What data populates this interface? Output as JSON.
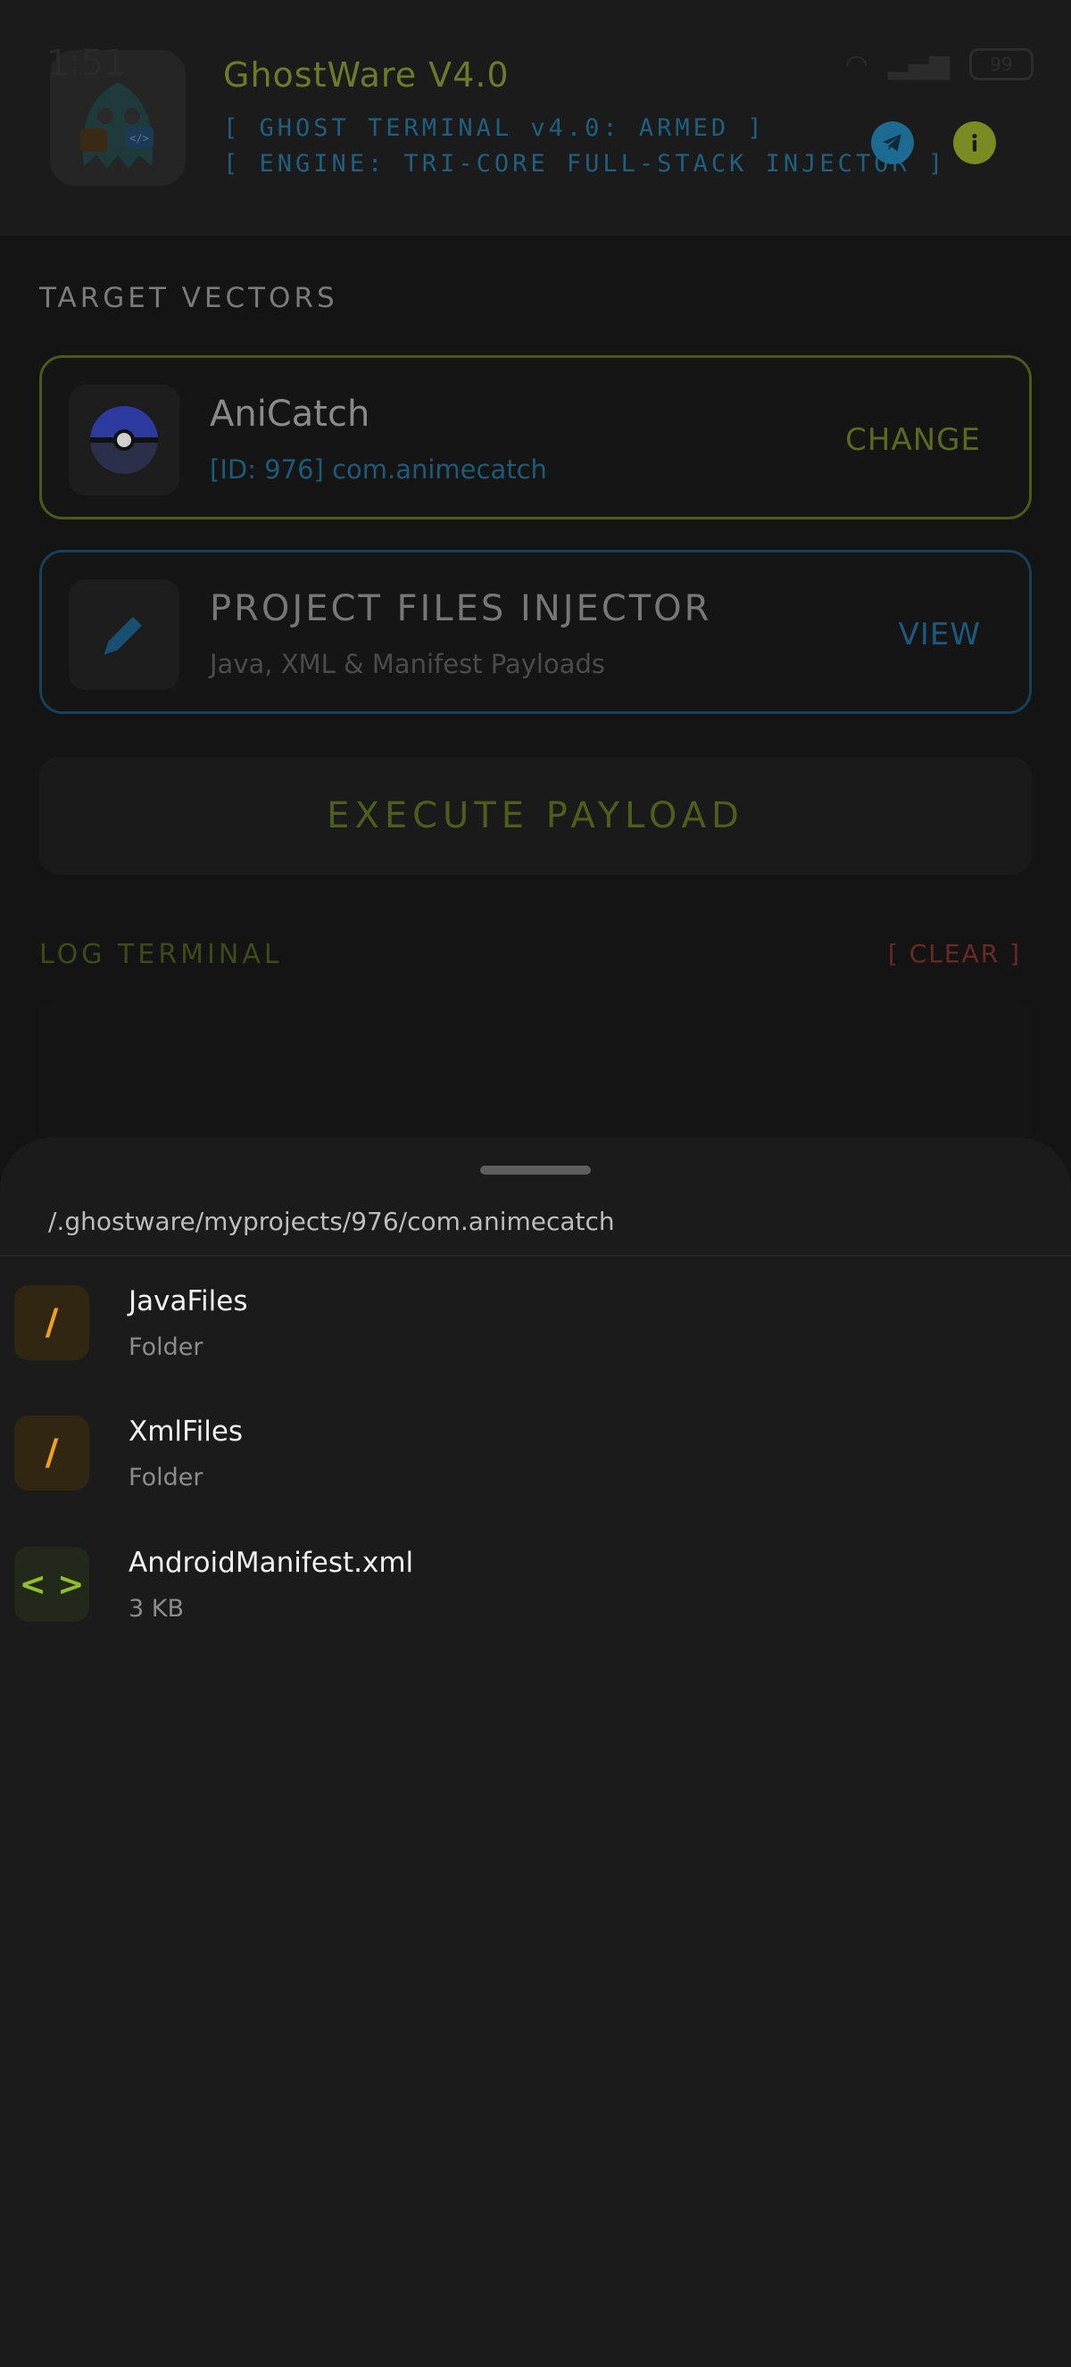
{
  "status_bar": {
    "time": "1:51",
    "battery": "99"
  },
  "header": {
    "app_title": "GhostWare V4.0",
    "tag_line_1": "[ GHOST TERMINAL v4.0: ARMED ]",
    "tag_line_2": "[ ENGINE: TRI-CORE FULL-STACK INJECTOR ]"
  },
  "main": {
    "section_label": "TARGET VECTORS",
    "target_card": {
      "app_name": "AniCatch",
      "package_info": "[ID: 976] com.animecatch",
      "action_label": "CHANGE"
    },
    "injector_card": {
      "title": "PROJECT FILES INJECTOR",
      "subtitle": "Java, XML & Manifest Payloads",
      "action_label": "VIEW"
    },
    "execute_label": "EXECUTE PAYLOAD",
    "log": {
      "label": "LOG TERMINAL",
      "clear_label": "[ CLEAR ]"
    }
  },
  "sheet": {
    "path": "/.ghostware/myprojects/976/com.animecatch",
    "files": [
      {
        "name": "JavaFiles",
        "meta": "Folder",
        "icon": "folder-icon",
        "glyph": "/"
      },
      {
        "name": "XmlFiles",
        "meta": "Folder",
        "icon": "folder-icon",
        "glyph": "/"
      },
      {
        "name": "AndroidManifest.xml",
        "meta": "3 KB",
        "icon": "xml-file-icon",
        "glyph": "< >"
      }
    ]
  },
  "colors": {
    "accent_green": "#7a8b21",
    "accent_blue": "#1d6a92",
    "folder_orange": "#f0a020",
    "xml_green": "#8fbf2c",
    "clear_red": "#6a2a24"
  }
}
